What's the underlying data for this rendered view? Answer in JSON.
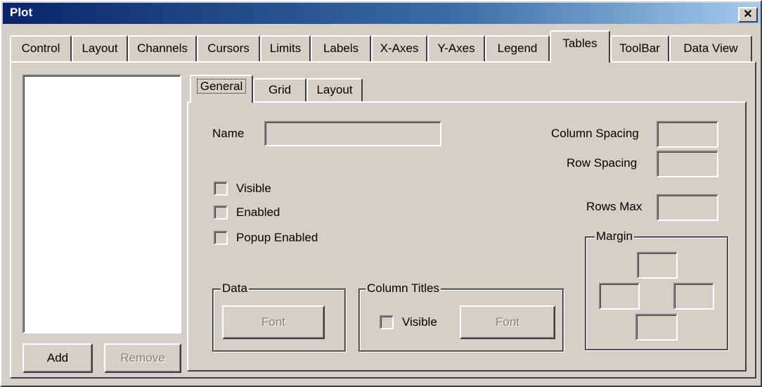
{
  "window": {
    "title": "Plot",
    "close_glyph": "✕"
  },
  "tabs": [
    "Control",
    "Layout",
    "Channels",
    "Cursors",
    "Limits",
    "Labels",
    "X-Axes",
    "Y-Axes",
    "Legend",
    "Tables",
    "ToolBar",
    "Data View"
  ],
  "active_tab": "Tables",
  "list": {
    "add_label": "Add",
    "remove_label": "Remove"
  },
  "subtabs": [
    "General",
    "Grid",
    "Layout"
  ],
  "active_subtab": "General",
  "general": {
    "name_label": "Name",
    "name_value": "",
    "visible_label": "Visible",
    "enabled_label": "Enabled",
    "popup_label": "Popup Enabled",
    "column_spacing_label": "Column Spacing",
    "row_spacing_label": "Row Spacing",
    "rows_max_label": "Rows Max",
    "margin_title": "Margin",
    "data_title": "Data",
    "data_font_label": "Font",
    "column_titles_title": "Column Titles",
    "column_titles_visible_label": "Visible",
    "column_titles_font_label": "Font"
  },
  "colors": {
    "face": "#d4d0c8",
    "title_start": "#0a246a",
    "title_end": "#a6caf0",
    "disabled_text": "#808080"
  }
}
